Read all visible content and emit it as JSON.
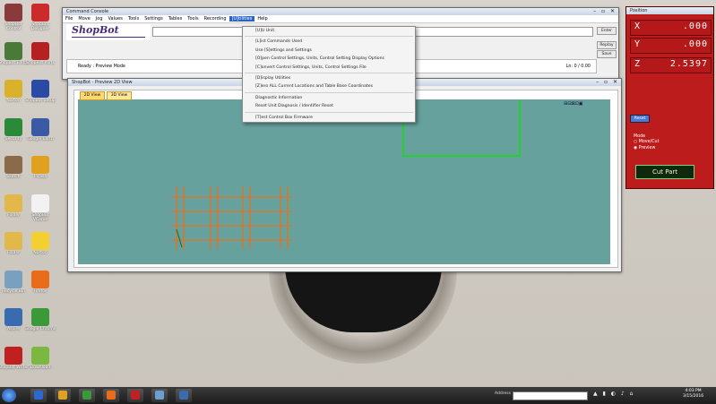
{
  "desktop": {
    "icons": [
      {
        "label": "ShopBot Control",
        "color": "#8a3a3a"
      },
      {
        "label": "ShopBot Designer",
        "color": "#cc2b2b"
      },
      {
        "label": "ShopBot Editor",
        "color": "#4a7a3a"
      },
      {
        "label": "ShopBot Parts",
        "color": "#b52121"
      },
      {
        "label": "Norton",
        "color": "#d9b12b"
      },
      {
        "label": "ShopBot Setup",
        "color": "#2b4aa6"
      },
      {
        "label": "Security",
        "color": "#2a8a3a"
      },
      {
        "label": "Google Earth",
        "color": "#3a5aa6"
      },
      {
        "label": "Sketch",
        "color": "#8a6a4a"
      },
      {
        "label": "Picasa",
        "color": "#e0a020"
      },
      {
        "label": "Folder",
        "color": "#e2b84a"
      },
      {
        "label": "ShopBot VCarve",
        "color": "#f2f2f2"
      },
      {
        "label": "Folder",
        "color": "#e2b84a"
      },
      {
        "label": "Norton",
        "color": "#f1d030"
      },
      {
        "label": "Recycle Bin",
        "color": "#7aa0c0"
      },
      {
        "label": "Firefox",
        "color": "#e86c1a"
      },
      {
        "label": "Aspire",
        "color": "#3a6ab0"
      },
      {
        "label": "Google Chrome",
        "color": "#3a9a3a"
      },
      {
        "label": "ShopBot Writer",
        "color": "#c02020"
      },
      {
        "label": "Download",
        "color": "#7ab840"
      }
    ]
  },
  "console": {
    "title": "Command Console",
    "menus": [
      "File",
      "Move",
      "Jog",
      "Values",
      "Tools",
      "Settings",
      "Tables",
      "Tools",
      "Recording",
      "[U]tilities",
      "Help"
    ],
    "active_menu_index": 9,
    "logo": "ShopBot",
    "status_text": "Ready : Preview Mode",
    "status_right": "Ln: 0 / 0.00",
    "buttons": {
      "enter": "Enter",
      "replay": "Replay",
      "save": "Save"
    }
  },
  "utilities_menu": {
    "items": [
      "[U]U Unit",
      "[L]ist Commands Used",
      "Use [S]ettings and Settings",
      "[O]pen Control Settings, Units, Control Setting Display Options",
      "[C]onvert Control Settings, Units, Control Settings File",
      "[D]isplay Utilities",
      "[Z]ero ALL Current Locations and Table Base Coordinates",
      "Diagnostic Information",
      "Reset Unit Diagnosis / Identifier Reset",
      "[T]est Control Box Firmware"
    ]
  },
  "preview": {
    "title": "ShopBot - Preview 2D View",
    "tabs": [
      "2D View",
      "3D View"
    ]
  },
  "position_panel": {
    "title": "Position",
    "axes": [
      {
        "label": "X",
        "value": ".000"
      },
      {
        "label": "Y",
        "value": ".000"
      },
      {
        "label": "Z",
        "value": "2.5397"
      }
    ],
    "mode_label": "Mode",
    "mode_options": [
      "Move/Cut",
      "Preview"
    ],
    "selected_mode": "Preview",
    "cut_button": "Cut Part",
    "small_button": "Reset"
  },
  "taskbar": {
    "search_label": "Address",
    "clock_time": "4:03 PM",
    "clock_date": "3/15/2016",
    "colors": [
      "#2a6ad0",
      "#e0a020",
      "#3a9a3a",
      "#e86c1a",
      "#c02020",
      "#6aa0d0",
      "#3a6ab0"
    ]
  }
}
